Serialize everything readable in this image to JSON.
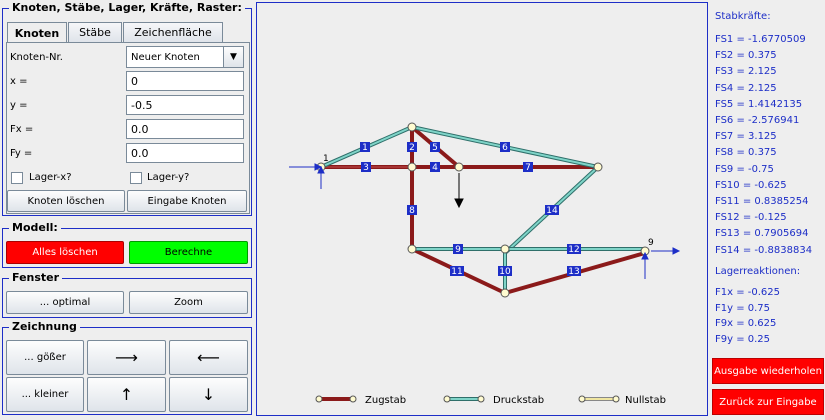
{
  "sections": {
    "knoten": "Knoten, Stäbe, Lager, Kräfte, Raster:",
    "modell": "Modell:",
    "fenster": "Fenster",
    "zeichnung": "Zeichnung"
  },
  "tabs": [
    "Knoten",
    "Stäbe",
    "Zeichenfläche"
  ],
  "form": {
    "node_label": "Knoten-Nr.",
    "node_select": "Neuer Knoten",
    "x_label": "x =",
    "x_value": "0",
    "y_label": "y =",
    "y_value": "-0.5",
    "fx_label": "Fx =",
    "fx_value": "0.0",
    "fy_label": "Fy =",
    "fy_value": "0.0",
    "lagerx": "Lager-x?",
    "lagery": "Lager-y?",
    "delete_node": "Knoten löschen",
    "input_node": "Eingabe Knoten"
  },
  "modell": {
    "clear": "Alles löschen",
    "compute": "Berechne",
    "clear_color": "#ff0000",
    "compute_color": "#00ff00"
  },
  "fenster": {
    "optimal": "... optimal",
    "zoom": "Zoom"
  },
  "zeichnung": {
    "bigger": "... gößer",
    "smaller": "... kleiner"
  },
  "drawing": {
    "members": [
      "1",
      "2",
      "3",
      "4",
      "5",
      "6",
      "7",
      "8",
      "9",
      "10",
      "11",
      "12",
      "13",
      "14"
    ],
    "nodes": [
      "1",
      "9"
    ],
    "legend": [
      "Zugstab",
      "Druckstab",
      "Nullstab"
    ],
    "colors": {
      "zug": "#8b1a1a",
      "druck": "#7fd4c8",
      "null": "#f0e6a0"
    }
  },
  "results": {
    "stab_title": "Stabkräfte:",
    "stab": [
      "FS1 = -1.6770509",
      "FS2 = 0.375",
      "FS3 = 2.125",
      "FS4 = 2.125",
      "FS5 = 1.4142135",
      "FS6 = -2.576941",
      "FS7 = 3.125",
      "FS8 = 0.375",
      "FS9 = -0.75",
      "FS10 = -0.625",
      "FS11 = 0.8385254",
      "FS12 = -0.125",
      "FS13 = 0.7905694",
      "FS14 = -0.8838834"
    ],
    "lager_title": "Lagerreaktionen:",
    "lager": [
      "F1x = -0.625",
      "F1y = 0.75",
      "F9x = 0.625",
      "F9y = 0.25"
    ],
    "repeat": "Ausgabe wiederholen",
    "back": "Zurück zur Eingabe"
  }
}
